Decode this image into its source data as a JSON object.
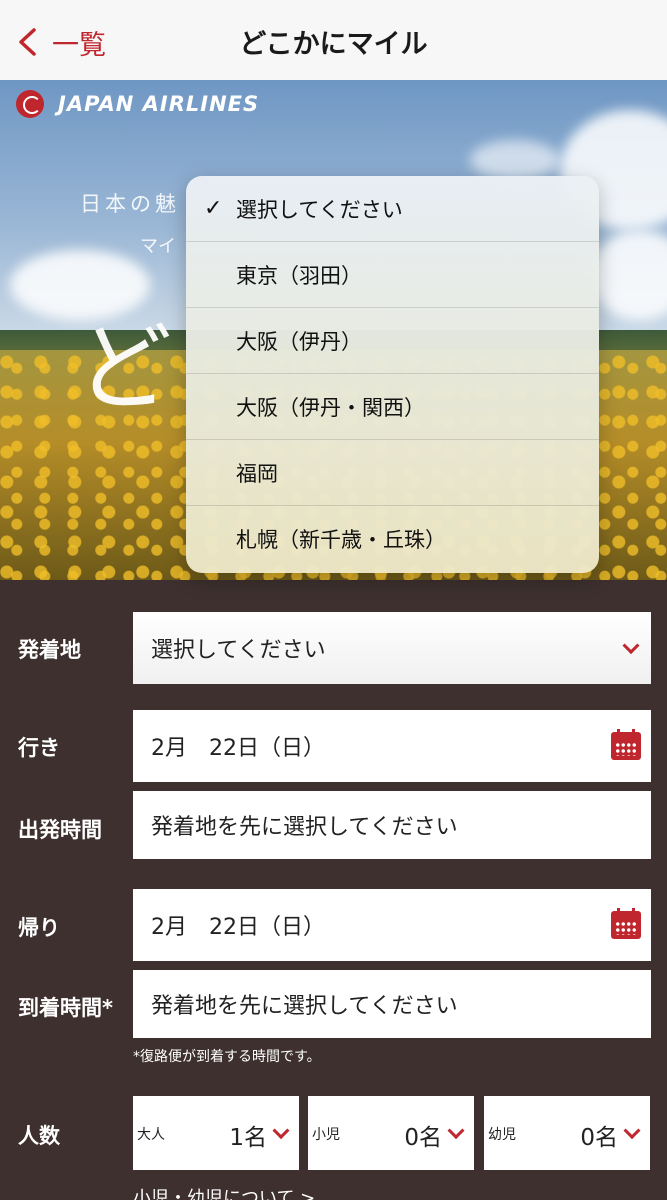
{
  "nav": {
    "back_label": "一覧",
    "title": "どこかにマイル"
  },
  "hero": {
    "brand": "JAPAN AIRLINES",
    "text_line1": "日本の魅",
    "text_line2": "マイ",
    "text_big": "ど"
  },
  "dropdown": {
    "selected_index": 0,
    "options": [
      "選択してください",
      "東京（羽田）",
      "大阪（伊丹）",
      "大阪（伊丹・関西）",
      "福岡",
      "札幌（新千歳・丘珠）"
    ]
  },
  "form": {
    "origin": {
      "label": "発着地",
      "value": "選択してください"
    },
    "outbound": {
      "label": "行き",
      "value": "2月　22日（日）"
    },
    "departure_time": {
      "label": "出発時間",
      "value": "発着地を先に選択してください"
    },
    "return": {
      "label": "帰り",
      "value": "2月　22日（日）"
    },
    "arrival_time": {
      "label": "到着時間*",
      "value": "発着地を先に選択してください"
    },
    "note": "*復路便が到着する時間です。",
    "passengers": {
      "label": "人数",
      "adult": {
        "label": "大人",
        "value": "1名"
      },
      "child": {
        "label": "小児",
        "value": "0名"
      },
      "infant": {
        "label": "幼児",
        "value": "0名"
      }
    },
    "child_info_link": "小児・幼児について >"
  },
  "colors": {
    "accent": "#c0262d",
    "form_bg": "#3d302e"
  },
  "icons": {
    "back": "chevron-left-icon",
    "calendar": "calendar-icon",
    "dropdown": "chevron-down-icon",
    "check": "checkmark-icon"
  }
}
